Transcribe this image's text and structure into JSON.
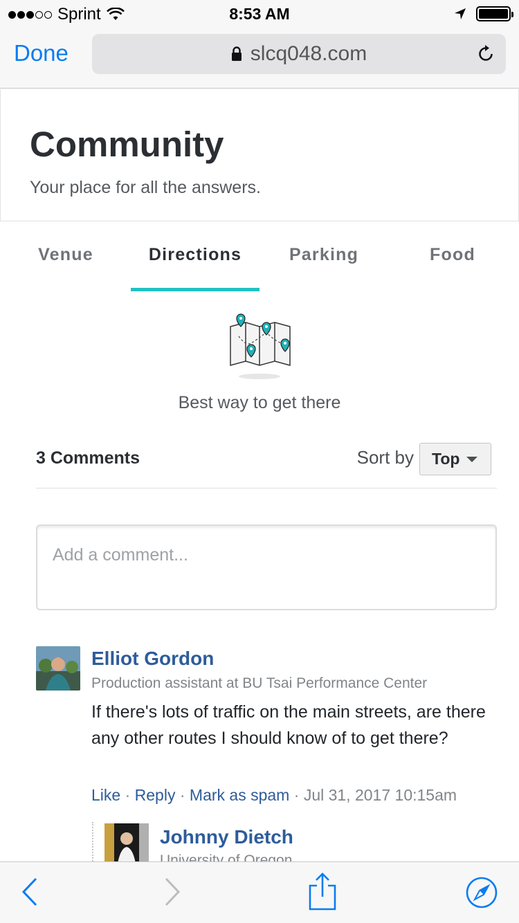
{
  "status_bar": {
    "carrier": "Sprint",
    "time": "8:53 AM"
  },
  "browser": {
    "done_label": "Done",
    "url": "slcq048.com"
  },
  "header": {
    "title": "Community",
    "subtitle": "Your place for all the answers."
  },
  "tabs": [
    {
      "label": "Venue",
      "active": false
    },
    {
      "label": "Directions",
      "active": true
    },
    {
      "label": "Parking",
      "active": false
    },
    {
      "label": "Food",
      "active": false
    }
  ],
  "hero": {
    "caption": "Best way to get there",
    "icon": "map-pins-icon"
  },
  "comments": {
    "count_label": "3 Comments",
    "sort_label": "Sort by",
    "sort_value": "Top",
    "input_placeholder": "Add a comment..."
  },
  "comment_list": [
    {
      "name": "Elliot Gordon",
      "role": "Production assistant at BU Tsai Performance Center",
      "body": "If there's lots of traffic on the main streets, are there any other routes I should know of to get there?",
      "actions": {
        "like": "Like",
        "reply": "Reply",
        "spam": "Mark as spam"
      },
      "timestamp": "Jul 31, 2017 10:15am"
    }
  ],
  "replies": [
    {
      "name": "Johnny Dietch",
      "role": "University of Oregon"
    }
  ],
  "colors": {
    "accent": "#20c1c3",
    "link": "#2e5c9a",
    "ios_blue": "#0a7cf0"
  }
}
